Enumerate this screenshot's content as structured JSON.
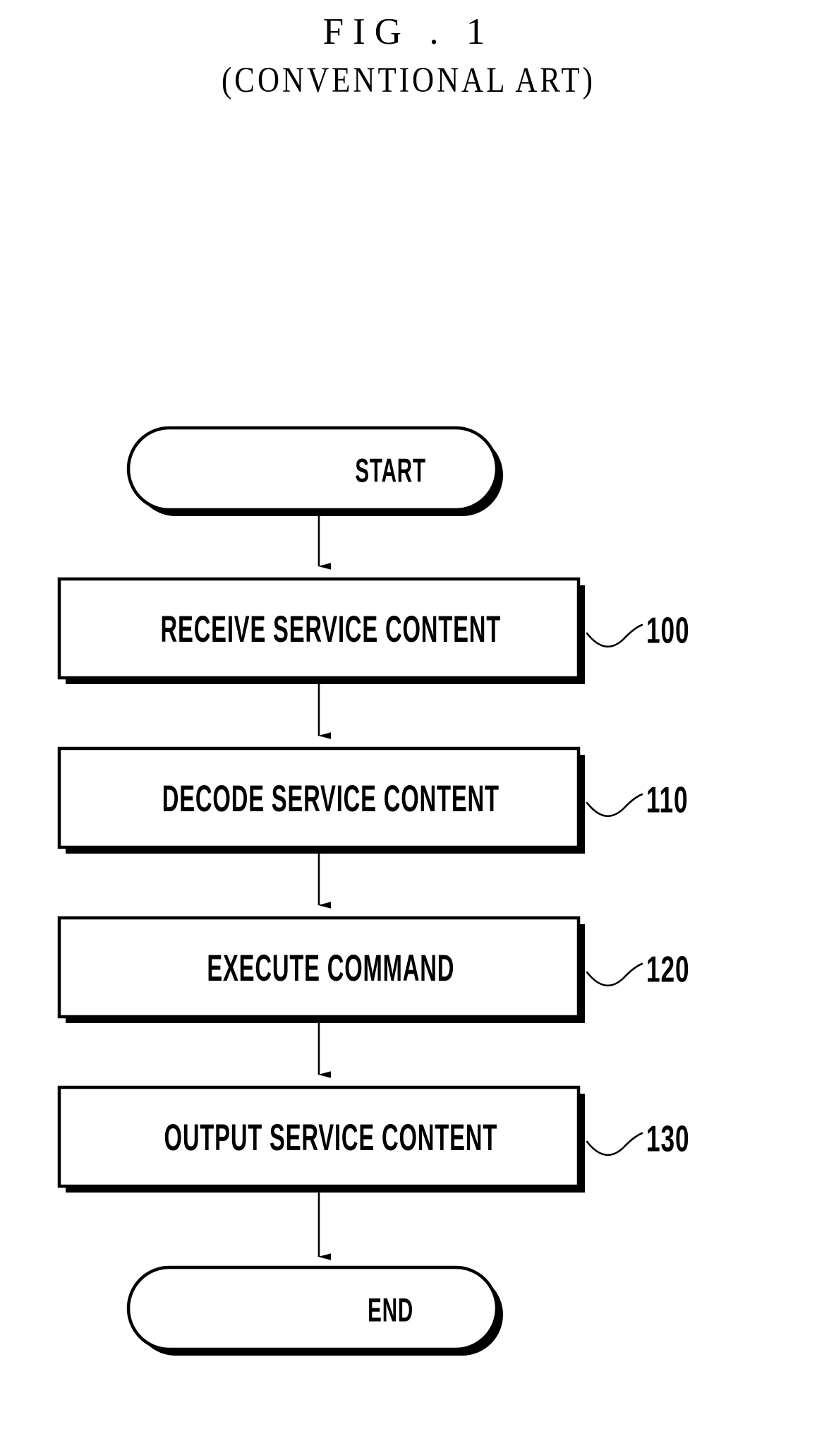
{
  "figure": {
    "title": "FIG . 1",
    "subtitle": "(CONVENTIONAL ART)"
  },
  "flowchart": {
    "nodes": [
      {
        "id": "start",
        "type": "terminator",
        "label": "START",
        "ref": ""
      },
      {
        "id": "step100",
        "type": "process",
        "label": "RECEIVE SERVICE CONTENT",
        "ref": "100"
      },
      {
        "id": "step110",
        "type": "process",
        "label": "DECODE SERVICE CONTENT",
        "ref": "110"
      },
      {
        "id": "step120",
        "type": "process",
        "label": "EXECUTE COMMAND",
        "ref": "120"
      },
      {
        "id": "step130",
        "type": "process",
        "label": "OUTPUT SERVICE CONTENT",
        "ref": "130"
      },
      {
        "id": "end",
        "type": "terminator",
        "label": "END",
        "ref": ""
      }
    ],
    "edges": [
      {
        "from": "start",
        "to": "step100"
      },
      {
        "from": "step100",
        "to": "step110"
      },
      {
        "from": "step110",
        "to": "step120"
      },
      {
        "from": "step120",
        "to": "step130"
      },
      {
        "from": "step130",
        "to": "end"
      }
    ]
  },
  "colors": {
    "ink": "#000000",
    "paper": "#ffffff"
  }
}
